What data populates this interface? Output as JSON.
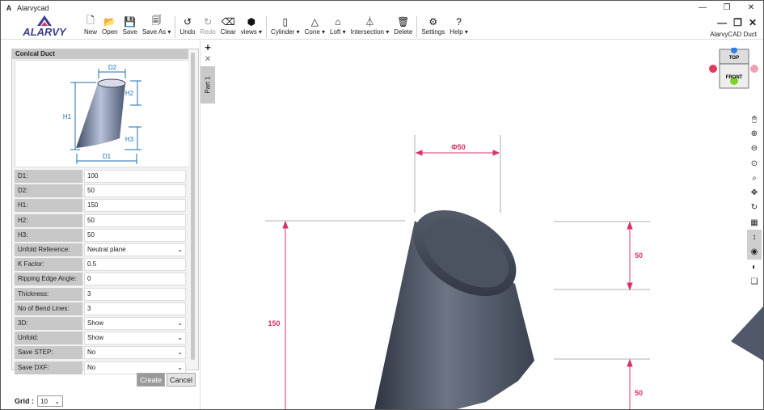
{
  "window": {
    "title": "Alarvycad",
    "minimize_glyph": "—",
    "restore_glyph": "❐",
    "close_glyph": "✕"
  },
  "logo": {
    "text": "ALARVY"
  },
  "toolbar": {
    "groups": [
      [
        {
          "icon": "new-file-icon",
          "glyph": "🗋",
          "label": "New"
        },
        {
          "icon": "open-folder-icon",
          "glyph": "📂",
          "label": "Open"
        },
        {
          "icon": "save-icon",
          "glyph": "💾",
          "label": "Save"
        },
        {
          "icon": "save-as-icon",
          "glyph": "🗐",
          "label": "Save As ▾"
        }
      ],
      [
        {
          "icon": "undo-icon",
          "glyph": "↺",
          "label": "Undo"
        },
        {
          "icon": "redo-icon",
          "glyph": "↻",
          "label": "Redo",
          "disabled": true
        },
        {
          "icon": "eraser-icon",
          "glyph": "⌫",
          "label": "Clear"
        },
        {
          "icon": "cube-icon",
          "glyph": "⬢",
          "label": "views ▾"
        }
      ],
      [
        {
          "icon": "cylinder-icon",
          "glyph": "▯",
          "label": "Cylinder ▾"
        },
        {
          "icon": "cone-icon",
          "glyph": "△",
          "label": "Cone ▾"
        },
        {
          "icon": "loft-icon",
          "glyph": "⌂",
          "label": "Loft ▾"
        },
        {
          "icon": "intersection-icon",
          "glyph": "⏃",
          "label": "Intersection ▾"
        },
        {
          "icon": "trash-icon",
          "glyph": "🗑",
          "label": "Delete"
        }
      ],
      [
        {
          "icon": "gear-icon",
          "glyph": "⚙",
          "label": "Settings"
        },
        {
          "icon": "help-icon",
          "glyph": "?",
          "label": "Help ▾"
        }
      ]
    ],
    "brand_controls": [
      "—",
      "❐",
      "✕"
    ],
    "brand_name": "AlarvyCAD Duct"
  },
  "panel": {
    "title": "Conical Duct",
    "illustration_labels": {
      "d2": "D2",
      "h2": "H2",
      "h1": "H1",
      "h3": "H3",
      "d1": "D1"
    },
    "fields": [
      {
        "label": "D1:",
        "value": "100",
        "dropdown": false
      },
      {
        "label": "D2:",
        "value": "50",
        "dropdown": false
      },
      {
        "label": "H1:",
        "value": "150",
        "dropdown": false
      },
      {
        "label": "H2:",
        "value": "50",
        "dropdown": false
      },
      {
        "label": "H3:",
        "value": "50",
        "dropdown": false
      },
      {
        "label": "Unfold Reference:",
        "value": "Neutral plane",
        "dropdown": true
      },
      {
        "label": "K Factor:",
        "value": "0.5",
        "dropdown": false
      },
      {
        "label": "Ripping Edge Angle:",
        "value": "0",
        "dropdown": false
      },
      {
        "label": "Thickness:",
        "value": "3",
        "dropdown": false
      },
      {
        "label": "No of Bend Lines:",
        "value": "3",
        "dropdown": false
      },
      {
        "label": "3D:",
        "value": "Show",
        "dropdown": true
      },
      {
        "label": "Unfold:",
        "value": "Show",
        "dropdown": true
      },
      {
        "label": "Save STEP:",
        "value": "No",
        "dropdown": true
      },
      {
        "label": "Save DXF:",
        "value": "No",
        "dropdown": true
      }
    ],
    "create_label": "Create",
    "cancel_label": "Cancel"
  },
  "grid": {
    "label": "Grid :",
    "value": "10"
  },
  "part_tabs": {
    "add_glyph": "+",
    "close_glyph": "✕",
    "tab_label": "Part 1"
  },
  "viewport": {
    "dimensions": {
      "top_diameter": "Φ50",
      "height": "150",
      "right_top": "50",
      "right_bottom": "50"
    },
    "dimension_color": "#d6336c",
    "body_color": "#4a5160"
  },
  "viewcube": {
    "top_label": "TOP",
    "front_label": "FRONT"
  },
  "view_tools": [
    {
      "icon": "mouse-icon",
      "glyph": "🖱",
      "active": false
    },
    {
      "icon": "zoom-in-icon",
      "glyph": "⊕",
      "active": false
    },
    {
      "icon": "zoom-out-icon",
      "glyph": "⊖",
      "active": false
    },
    {
      "icon": "zoom-fit-icon",
      "glyph": "⊙",
      "active": false
    },
    {
      "icon": "zoom-window-icon",
      "glyph": "⌕",
      "active": false
    },
    {
      "icon": "pan-icon",
      "glyph": "✥",
      "active": false
    },
    {
      "icon": "rotate-icon",
      "glyph": "↻",
      "active": false
    },
    {
      "icon": "grid-icon",
      "glyph": "▦",
      "active": false
    },
    {
      "icon": "vertical-arrow-icon",
      "glyph": "↕",
      "active": true
    },
    {
      "icon": "eye-icon",
      "glyph": "◉",
      "active": true
    },
    {
      "icon": "contrast-icon",
      "glyph": "◐",
      "active": false
    },
    {
      "icon": "layers-icon",
      "glyph": "❏",
      "active": false
    }
  ]
}
